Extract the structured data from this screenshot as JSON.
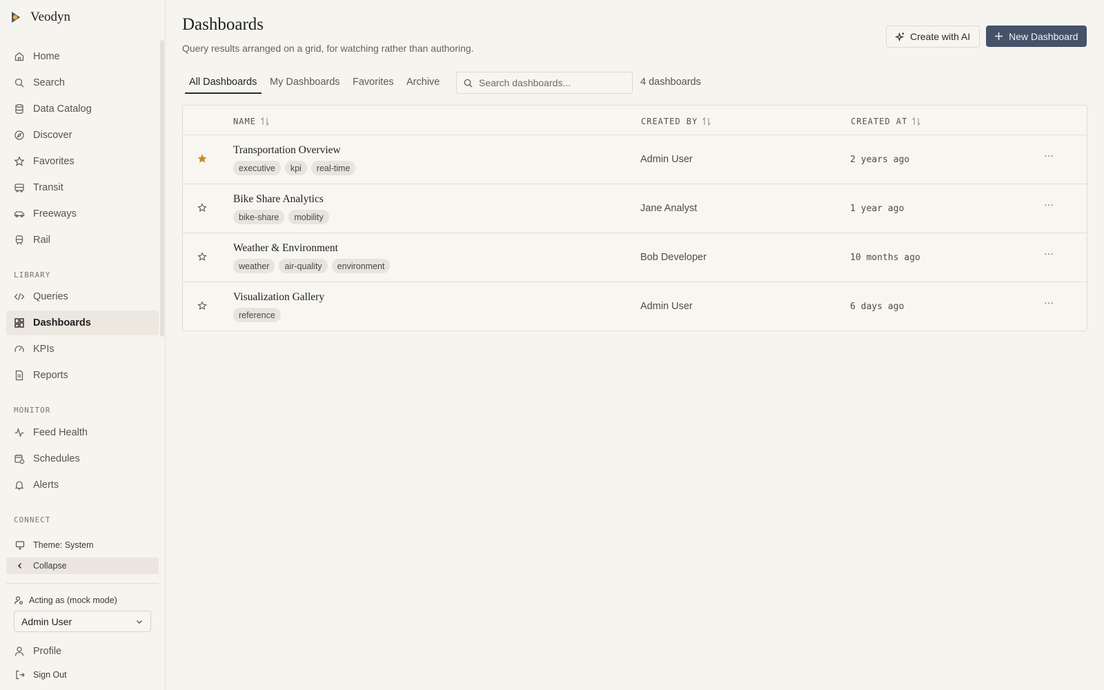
{
  "brand": {
    "name": "Veodyn"
  },
  "sidebar": {
    "items": [
      {
        "label": "Home",
        "icon": "home-icon"
      },
      {
        "label": "Search",
        "icon": "search-icon"
      },
      {
        "label": "Data Catalog",
        "icon": "database-icon"
      },
      {
        "label": "Discover",
        "icon": "compass-icon"
      },
      {
        "label": "Favorites",
        "icon": "star-icon"
      },
      {
        "label": "Transit",
        "icon": "bus-icon"
      },
      {
        "label": "Freeways",
        "icon": "car-icon"
      },
      {
        "label": "Rail",
        "icon": "train-icon"
      }
    ],
    "library_title": "LIBRARY",
    "library": [
      {
        "label": "Queries",
        "icon": "code-icon"
      },
      {
        "label": "Dashboards",
        "icon": "dashboard-icon",
        "active": true
      },
      {
        "label": "KPIs",
        "icon": "gauge-icon"
      },
      {
        "label": "Reports",
        "icon": "report-icon"
      }
    ],
    "monitor_title": "MONITOR",
    "monitor": [
      {
        "label": "Feed Health",
        "icon": "activity-icon"
      },
      {
        "label": "Schedules",
        "icon": "calendar-clock-icon"
      },
      {
        "label": "Alerts",
        "icon": "bell-icon"
      }
    ],
    "connect_title": "CONNECT",
    "theme_label": "Theme: System",
    "collapse_label": "Collapse",
    "acting_label": "Acting as (mock mode)",
    "acting_user": "Admin User",
    "profile_label": "Profile",
    "signout_label": "Sign Out"
  },
  "header": {
    "title": "Dashboards",
    "subtitle": "Query results arranged on a grid, for watching rather than authoring.",
    "create_ai_label": "Create with AI",
    "new_label": "New Dashboard"
  },
  "tabs": [
    "All Dashboards",
    "My Dashboards",
    "Favorites",
    "Archive"
  ],
  "search": {
    "placeholder": "Search dashboards..."
  },
  "count_label": "4 dashboards",
  "table": {
    "columns": [
      "NAME",
      "CREATED BY",
      "CREATED AT"
    ],
    "rows": [
      {
        "name": "Transportation Overview",
        "tags": [
          "executive",
          "kpi",
          "real-time"
        ],
        "created_by": "Admin User",
        "created_at": "2 years ago",
        "favorite": true
      },
      {
        "name": "Bike Share Analytics",
        "tags": [
          "bike-share",
          "mobility"
        ],
        "created_by": "Jane Analyst",
        "created_at": "1 year ago",
        "favorite": false
      },
      {
        "name": "Weather & Environment",
        "tags": [
          "weather",
          "air-quality",
          "environment"
        ],
        "created_by": "Bob Developer",
        "created_at": "10 months ago",
        "favorite": false
      },
      {
        "name": "Visualization Gallery",
        "tags": [
          "reference"
        ],
        "created_by": "Admin User",
        "created_at": "6 days ago",
        "favorite": false
      }
    ],
    "more_label": "···"
  },
  "colors": {
    "accent": "#45526a",
    "favorite_star": "#c8892a",
    "background": "#f6f4ef"
  }
}
